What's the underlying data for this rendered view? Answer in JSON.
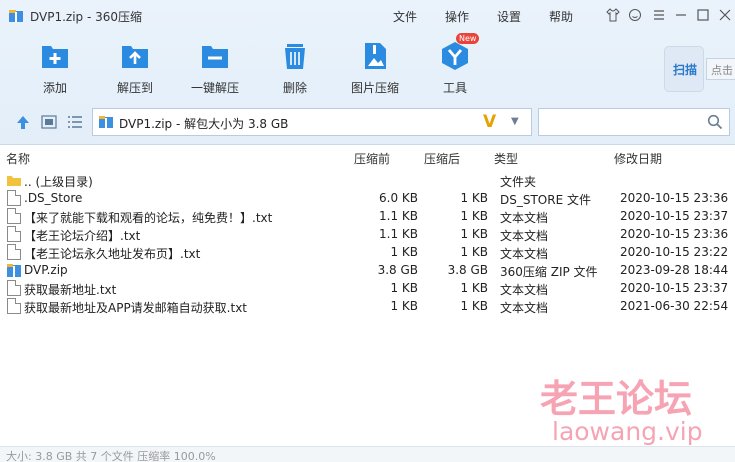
{
  "window": {
    "title": "DVP1.zip - 360压缩",
    "menus": [
      "文件",
      "操作",
      "设置",
      "帮助"
    ]
  },
  "toolbar": {
    "buttons": [
      {
        "label": "添加",
        "icon": "add-icon"
      },
      {
        "label": "解压到",
        "icon": "extract-to-icon"
      },
      {
        "label": "一键解压",
        "icon": "one-click-extract-icon"
      },
      {
        "label": "删除",
        "icon": "delete-icon"
      },
      {
        "label": "图片压缩",
        "icon": "image-compress-icon"
      },
      {
        "label": "工具",
        "icon": "tools-icon"
      }
    ],
    "new_badge": "New",
    "scan_label": "扫描",
    "scan_hint": "点击"
  },
  "address": {
    "text": "DVP1.zip - 解包大小为 3.8 GB"
  },
  "columns": {
    "name": "名称",
    "compressed": "压缩前",
    "original": "压缩后",
    "type": "类型",
    "date": "修改日期"
  },
  "files": [
    {
      "name": ".. (上级目录)",
      "csize": "",
      "osize": "",
      "type": "文件夹",
      "date": "",
      "icon": "folder-icon"
    },
    {
      "name": ".DS_Store",
      "csize": "6.0 KB",
      "osize": "1 KB",
      "type": "DS_STORE 文件",
      "date": "2020-10-15 23:36",
      "icon": "file-icon"
    },
    {
      "name": "【来了就能下载和观看的论坛，纯免费！】.txt",
      "csize": "1.1 KB",
      "osize": "1 KB",
      "type": "文本文档",
      "date": "2020-10-15 23:37",
      "icon": "text-file-icon"
    },
    {
      "name": "【老王论坛介绍】.txt",
      "csize": "1.1 KB",
      "osize": "1 KB",
      "type": "文本文档",
      "date": "2020-10-15 23:36",
      "icon": "text-file-icon"
    },
    {
      "name": "【老王论坛永久地址发布页】.txt",
      "csize": "1 KB",
      "osize": "1 KB",
      "type": "文本文档",
      "date": "2020-10-15 23:22",
      "icon": "text-file-icon"
    },
    {
      "name": "DVP.zip",
      "csize": "3.8 GB",
      "osize": "3.8 GB",
      "type": "360压缩 ZIP 文件",
      "date": "2023-09-28 18:44",
      "icon": "zip-icon"
    },
    {
      "name": "获取最新地址.txt",
      "csize": "1 KB",
      "osize": "1 KB",
      "type": "文本文档",
      "date": "2020-10-15 23:37",
      "icon": "text-file-icon"
    },
    {
      "name": "获取最新地址及APP请发邮箱自动获取.txt",
      "csize": "1 KB",
      "osize": "1 KB",
      "type": "文本文档",
      "date": "2021-06-30 22:54",
      "icon": "text-file-icon"
    }
  ],
  "watermark": {
    "line1": "老王论坛",
    "line2": "laowang.vip"
  },
  "status": {
    "text": "大小: 3.8 GB 共 7 个文件 压缩率 100.0%"
  },
  "colors": {
    "accent": "#2a8be0",
    "watermark": "#f05a78"
  }
}
